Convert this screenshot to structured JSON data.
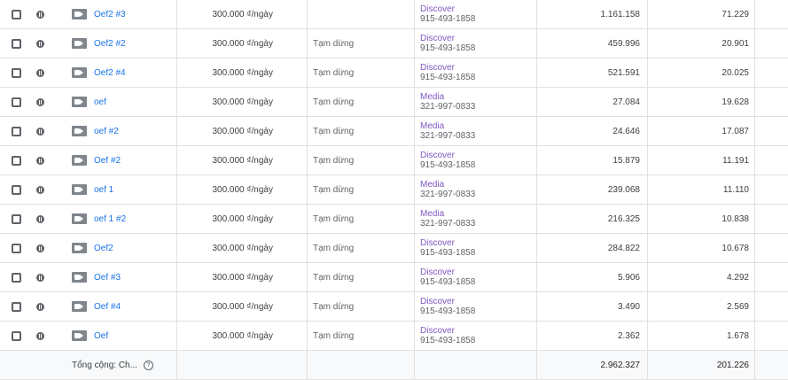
{
  "rows": [
    {
      "name": "Oef2 #3",
      "budget": "300.000 ₫/ngày",
      "status": "",
      "type": "Discover",
      "account": "915-493-1858",
      "v1": "1.161.158",
      "v2": "71.229"
    },
    {
      "name": "Oef2 #2",
      "budget": "300.000 ₫/ngày",
      "status": "Tạm dừng",
      "type": "Discover",
      "account": "915-493-1858",
      "v1": "459.996",
      "v2": "20.901"
    },
    {
      "name": "Oef2 #4",
      "budget": "300.000 ₫/ngày",
      "status": "Tạm dừng",
      "type": "Discover",
      "account": "915-493-1858",
      "v1": "521.591",
      "v2": "20.025"
    },
    {
      "name": "oef",
      "budget": "300.000 ₫/ngày",
      "status": "Tạm dừng",
      "type": "Media",
      "account": "321-997-0833",
      "v1": "27.084",
      "v2": "19.628"
    },
    {
      "name": "oef #2",
      "budget": "300.000 ₫/ngày",
      "status": "Tạm dừng",
      "type": "Media",
      "account": "321-997-0833",
      "v1": "24.646",
      "v2": "17.087"
    },
    {
      "name": "Oef #2",
      "budget": "300.000 ₫/ngày",
      "status": "Tạm dừng",
      "type": "Discover",
      "account": "915-493-1858",
      "v1": "15.879",
      "v2": "11.191"
    },
    {
      "name": "oef 1",
      "budget": "300.000 ₫/ngày",
      "status": "Tạm dừng",
      "type": "Media",
      "account": "321-997-0833",
      "v1": "239.068",
      "v2": "11.110"
    },
    {
      "name": "oef 1 #2",
      "budget": "300.000 ₫/ngày",
      "status": "Tạm dừng",
      "type": "Media",
      "account": "321-997-0833",
      "v1": "216.325",
      "v2": "10.838"
    },
    {
      "name": "Oef2",
      "budget": "300.000 ₫/ngày",
      "status": "Tạm dừng",
      "type": "Discover",
      "account": "915-493-1858",
      "v1": "284.822",
      "v2": "10.678"
    },
    {
      "name": "Oef #3",
      "budget": "300.000 ₫/ngày",
      "status": "Tạm dừng",
      "type": "Discover",
      "account": "915-493-1858",
      "v1": "5.906",
      "v2": "4.292"
    },
    {
      "name": "Oef #4",
      "budget": "300.000 ₫/ngày",
      "status": "Tạm dừng",
      "type": "Discover",
      "account": "915-493-1858",
      "v1": "3.490",
      "v2": "2.569"
    },
    {
      "name": "Oef",
      "budget": "300.000 ₫/ngày",
      "status": "Tạm dừng",
      "type": "Discover",
      "account": "915-493-1858",
      "v1": "2.362",
      "v2": "1.678"
    }
  ],
  "footer": {
    "label": "Tổng cộng: Ch...",
    "help": "?",
    "v1": "2.962.327",
    "v2": "201.226"
  },
  "colors": {
    "link": "#1a73e8",
    "type": "#7e57c2",
    "border": "#e0e0e0"
  },
  "icons": {
    "checkbox": "checkbox-icon",
    "status": "pause-circle-icon",
    "campaign": "video-camera-icon",
    "help": "help-circle-icon"
  }
}
